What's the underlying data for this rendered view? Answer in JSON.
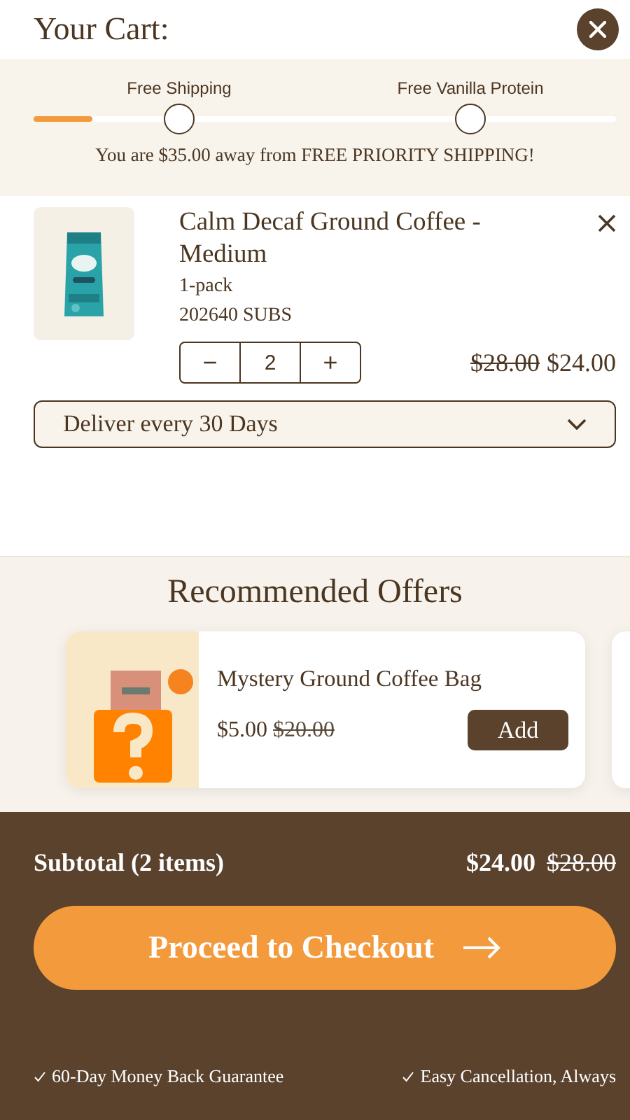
{
  "header": {
    "title": "Your Cart:"
  },
  "progress": {
    "level": 0.1,
    "milestones": [
      {
        "label": "Free Shipping",
        "reached": false
      },
      {
        "label": "Free Vanilla Protein",
        "reached": false
      }
    ],
    "message": "You are $35.00 away from FREE PRIORITY SHIPPING!"
  },
  "cart_items": [
    {
      "name": "Calm Decaf Ground Coffee - Medium",
      "variant": "1-pack",
      "sku": "202640 SUBS",
      "minus": "−",
      "quantity": "2",
      "plus": "+",
      "original_price": "$28.00",
      "price": "$24.00",
      "delivery": "Deliver every 30 Days"
    }
  ],
  "recommended": {
    "title": "Recommended Offers",
    "offers": [
      {
        "name": "Mystery Ground Coffee Bag",
        "price": "$5.00",
        "original_price": "$20.00",
        "button": "Add"
      }
    ]
  },
  "footer": {
    "subtotal_label": "Subtotal (2 items)",
    "total": "$24.00",
    "original_total": "$28.00",
    "checkout_button": "Proceed to Checkout",
    "guarantees": [
      "60-Day Money Back Guarantee",
      "Easy Cancellation, Always"
    ]
  }
}
